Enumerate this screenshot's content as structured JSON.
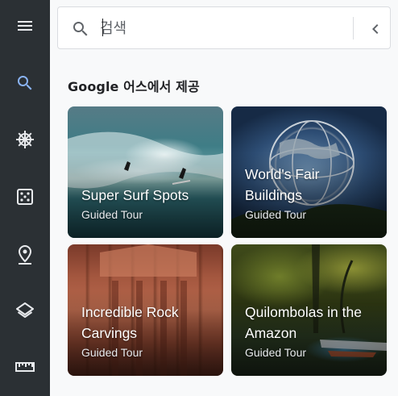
{
  "rail": {
    "items": [
      {
        "icon": "menu-icon",
        "label": "menu"
      },
      {
        "icon": "search-icon",
        "label": "search",
        "active": true
      },
      {
        "icon": "ship-wheel-icon",
        "label": "voyager"
      },
      {
        "icon": "dice-icon",
        "label": "feeling-lucky"
      },
      {
        "icon": "place-pin-icon",
        "label": "projects"
      },
      {
        "icon": "layers-icon",
        "label": "map-style"
      },
      {
        "icon": "ruler-icon",
        "label": "measure"
      }
    ],
    "active_color": "#8ab4f8",
    "icon_color": "#e8eaed"
  },
  "search": {
    "placeholder": "검색",
    "value": ""
  },
  "section": {
    "title": "Google 어스에서 제공"
  },
  "cards": [
    {
      "title": "Super Surf Spots",
      "subtitle": "Guided Tour",
      "image": "surfing-wave"
    },
    {
      "title": "World's Fair Buildings",
      "subtitle": "Guided Tour",
      "image": "unisphere"
    },
    {
      "title": "Incredible Rock Carvings",
      "subtitle": "Guided Tour",
      "image": "petra-treasury"
    },
    {
      "title": "Quilombolas in the Amazon",
      "subtitle": "Guided Tour",
      "image": "amazon-river"
    }
  ]
}
